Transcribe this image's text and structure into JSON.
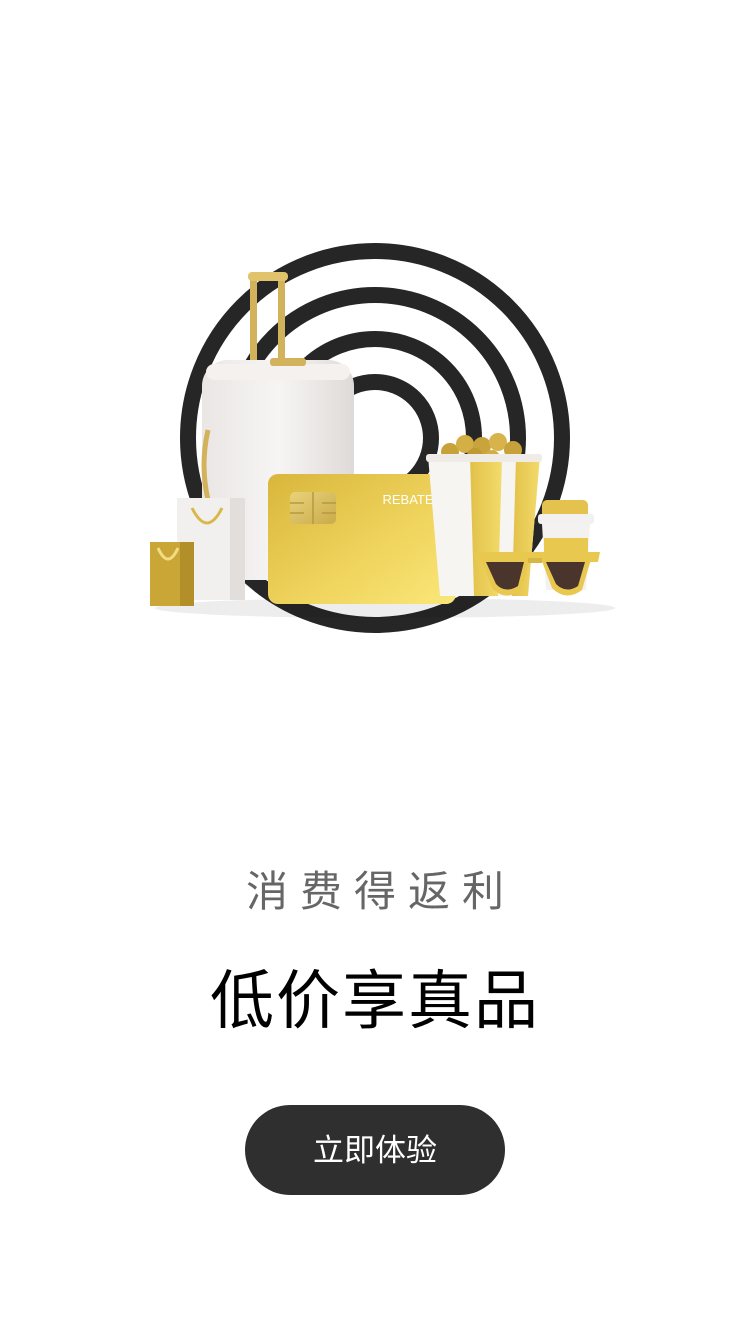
{
  "hero": {
    "card_label": "REBATE",
    "illustration_items": [
      "suitcase",
      "shopping-bags",
      "rebate-card",
      "popcorn-bucket",
      "coffee-cup",
      "sunglasses"
    ]
  },
  "subtitle": "消费得返利",
  "title": "低价享真品",
  "cta": {
    "label": "立即体验"
  },
  "colors": {
    "background": "#ffffff",
    "target_rings": "#262626",
    "gold": "#e8c24a",
    "button": "#2f2f2f",
    "button_text": "#ffffff",
    "subtitle_text": "#666666",
    "title_text": "#000000"
  }
}
